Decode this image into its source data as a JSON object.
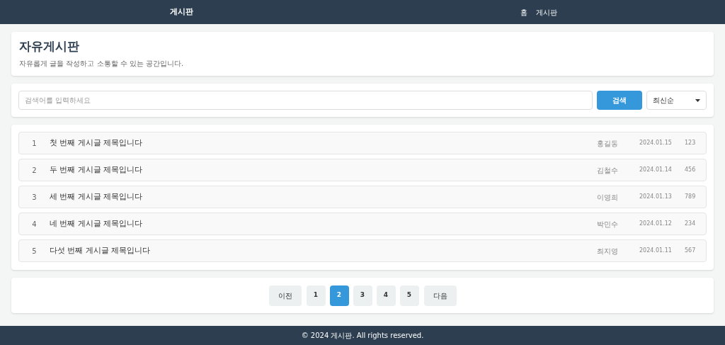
{
  "header": {
    "logo": "게시판",
    "nav": [
      {
        "label": "홈"
      },
      {
        "label": "게시판"
      }
    ]
  },
  "intro": {
    "title": "자유게시판",
    "description": "자유롭게 글을 작성하고 소통할 수 있는 공간입니다."
  },
  "search": {
    "placeholder": "검색어를 입력하세요",
    "button": "검색",
    "sort": "최신순"
  },
  "posts": [
    {
      "number": "1",
      "title": "첫 번째 게시글 제목입니다",
      "author": "홍길동",
      "date": "2024.01.15",
      "views": "123"
    },
    {
      "number": "2",
      "title": "두 번째 게시글 제목입니다",
      "author": "김철수",
      "date": "2024.01.14",
      "views": "456"
    },
    {
      "number": "3",
      "title": "세 번째 게시글 제목입니다",
      "author": "이영희",
      "date": "2024.01.13",
      "views": "789"
    },
    {
      "number": "4",
      "title": "네 번째 게시글 제목입니다",
      "author": "박민수",
      "date": "2024.01.12",
      "views": "234"
    },
    {
      "number": "5",
      "title": "다섯 번째 게시글 제목입니다",
      "author": "최지영",
      "date": "2024.01.11",
      "views": "567"
    }
  ],
  "pagination": {
    "prev": "이전",
    "next": "다음",
    "pages": [
      {
        "label": "1",
        "selected": false
      },
      {
        "label": "2",
        "selected": true
      },
      {
        "label": "3",
        "selected": false
      },
      {
        "label": "4",
        "selected": false
      },
      {
        "label": "5",
        "selected": false
      }
    ]
  },
  "footer": "© 2024 게시판. All rights reserved."
}
